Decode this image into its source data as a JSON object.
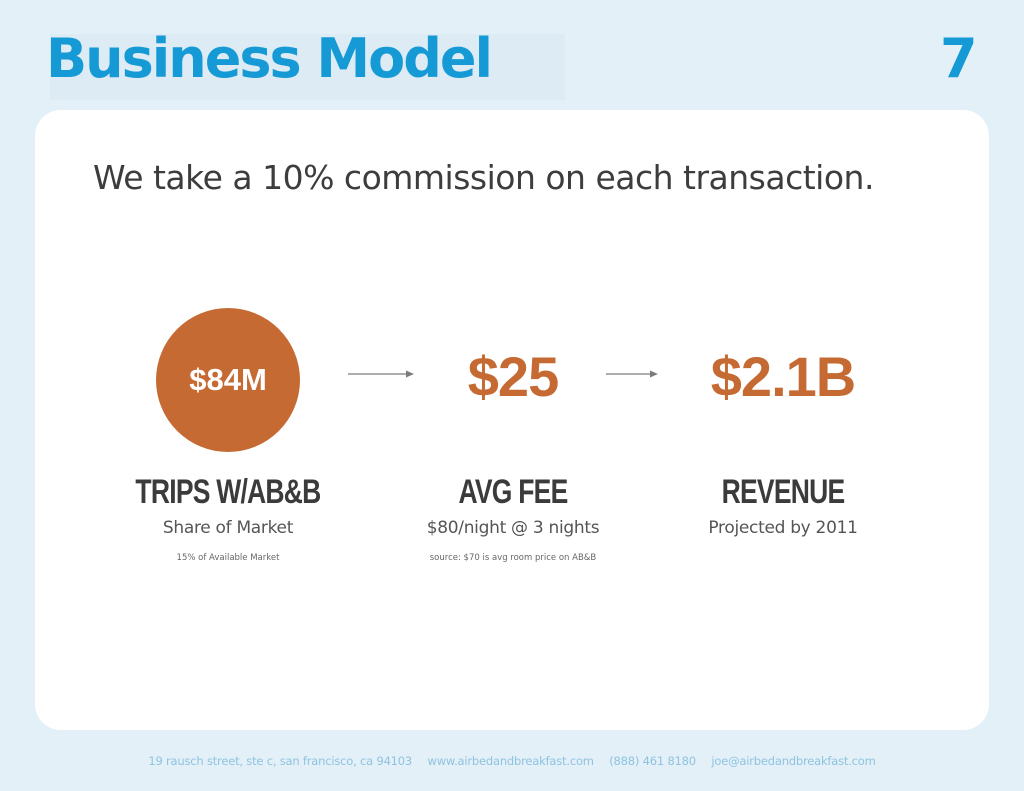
{
  "header": {
    "title": "Business Model",
    "page_number": "7"
  },
  "headline": "We take a 10% commission on each transaction.",
  "colors": {
    "title_blue": "#169ad6",
    "accent_orange": "#c66a33",
    "text_dark": "#3b3b3b",
    "footer_blue": "#8fc3e0",
    "background": "#e3f0f8"
  },
  "metrics": [
    {
      "value": "$84M",
      "label": "TRIPS W/AB&B",
      "subtitle": "Share of Market",
      "note": "15% of Available Market"
    },
    {
      "value": "$25",
      "label": "AVG FEE",
      "subtitle": "$80/night @ 3 nights",
      "note": "source: $70 is avg room price on AB&B"
    },
    {
      "value": "$2.1B",
      "label": "REVENUE",
      "subtitle": "Projected by 2011",
      "note": ""
    }
  ],
  "footer": {
    "address": "19 rausch street, ste c, san francisco, ca 94103",
    "website": "www.airbedandbreakfast.com",
    "phone": "(888) 461 8180",
    "email": "joe@airbedandbreakfast.com"
  }
}
